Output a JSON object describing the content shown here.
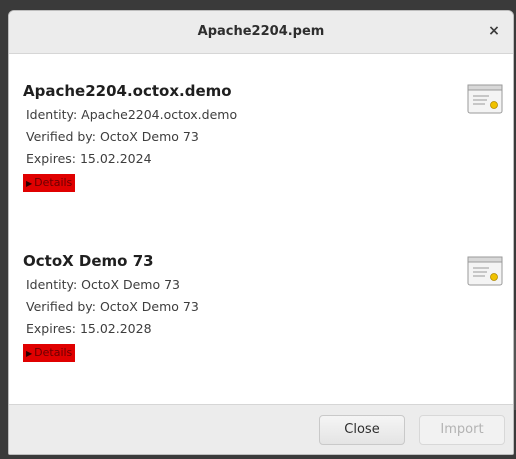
{
  "window": {
    "title": "Apache2204.pem",
    "close_glyph": "×"
  },
  "certificates": [
    {
      "name": "Apache2204.octox.demo",
      "identity": "Identity: Apache2204.octox.demo",
      "verified_by": "Verified by: OctoX Demo 73",
      "expires": "Expires: 15.02.2024",
      "details_label": "Details",
      "icon": "certificate-icon"
    },
    {
      "name": "OctoX Demo 73",
      "identity": "Identity: OctoX Demo 73",
      "verified_by": "Verified by: OctoX Demo 73",
      "expires": "Expires: 15.02.2028",
      "details_label": "Details",
      "icon": "certificate-icon"
    }
  ],
  "footer": {
    "close_label": "Close",
    "import_label": "Import"
  },
  "colors": {
    "details_highlight": "#e00000",
    "titlebar": "#ececec",
    "disabled_text": "#b3b3b3"
  }
}
